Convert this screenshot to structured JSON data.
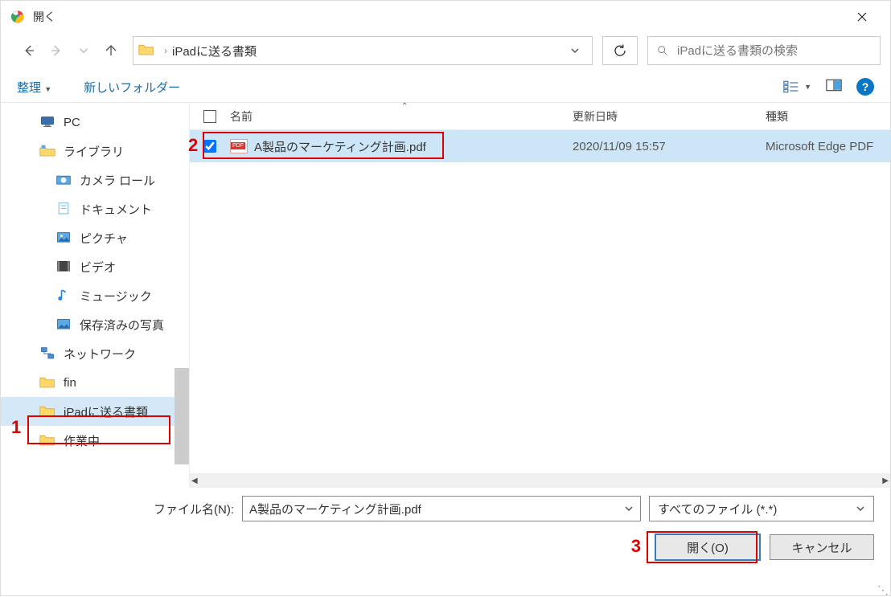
{
  "title": "開く",
  "breadcrumb": {
    "folder": "iPadに送る書類"
  },
  "search": {
    "placeholder": "iPadに送る書類の検索"
  },
  "toolbar": {
    "organize": "整理",
    "newfolder": "新しいフォルダー"
  },
  "columns": {
    "name": "名前",
    "date": "更新日時",
    "type": "種類"
  },
  "tree": {
    "items": [
      {
        "label": "PC",
        "icon": "pc"
      },
      {
        "label": "ライブラリ",
        "icon": "library"
      },
      {
        "label": "カメラ ロール",
        "icon": "camera",
        "indent": true
      },
      {
        "label": "ドキュメント",
        "icon": "doc",
        "indent": true
      },
      {
        "label": "ピクチャ",
        "icon": "pic",
        "indent": true
      },
      {
        "label": "ビデオ",
        "icon": "video",
        "indent": true
      },
      {
        "label": "ミュージック",
        "icon": "music",
        "indent": true
      },
      {
        "label": "保存済みの写真",
        "icon": "saved",
        "indent": true
      },
      {
        "label": "ネットワーク",
        "icon": "network"
      },
      {
        "label": "fin",
        "icon": "folder"
      },
      {
        "label": "iPadに送る書類",
        "icon": "folder",
        "selected": true
      },
      {
        "label": "作業中",
        "icon": "folder"
      }
    ]
  },
  "files": [
    {
      "name": "A製品のマーケティング計画.pdf",
      "date": "2020/11/09 15:57",
      "type": "Microsoft Edge PDF",
      "checked": true,
      "selected": true
    }
  ],
  "footer": {
    "fname_label": "ファイル名(N):",
    "fname_value": "A製品のマーケティング計画.pdf",
    "filter": "すべてのファイル (*.*)",
    "open": "開く(O)",
    "cancel": "キャンセル"
  },
  "callouts": {
    "c1": "1",
    "c2": "2",
    "c3": "3"
  }
}
